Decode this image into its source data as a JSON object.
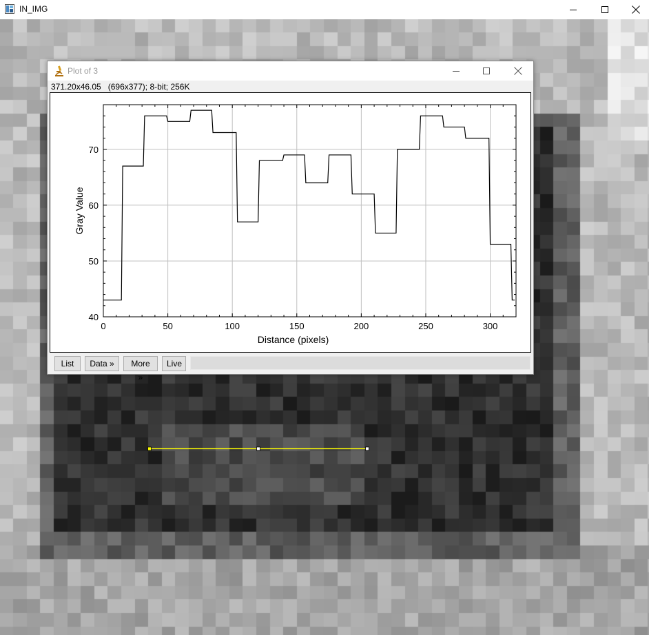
{
  "main_window": {
    "title": "IN_IMG",
    "icon": "imagej-image-icon",
    "controls": [
      "minimize-icon",
      "maximize-icon",
      "close-icon"
    ]
  },
  "plot_window": {
    "title": "Plot of 3",
    "icon": "microscope-icon",
    "info": "371.20x46.05   (696x377); 8-bit; 256K",
    "buttons": {
      "list": "List",
      "data": "Data »",
      "more": "More »",
      "live": "Live"
    },
    "status": ""
  },
  "colors": {
    "selection_line": "#ffff00",
    "plot_line": "#000000",
    "grid": "#c0c0c0"
  },
  "chart_data": {
    "type": "line",
    "step": true,
    "xlabel": "Distance (pixels)",
    "ylabel": "Gray Value",
    "xlim": [
      0,
      320
    ],
    "ylim": [
      40,
      78
    ],
    "xticks": [
      0,
      50,
      100,
      150,
      200,
      250,
      300
    ],
    "yticks": [
      40,
      50,
      60,
      70
    ],
    "grid": true,
    "series": [
      {
        "values": [
          [
            0,
            43
          ],
          [
            15,
            67
          ],
          [
            32,
            76
          ],
          [
            50,
            75
          ],
          [
            68,
            77
          ],
          [
            85,
            73
          ],
          [
            104,
            57
          ],
          [
            121,
            68
          ],
          [
            140,
            69
          ],
          [
            157,
            64
          ],
          [
            175,
            69
          ],
          [
            193,
            62
          ],
          [
            211,
            55
          ],
          [
            228,
            70
          ],
          [
            246,
            76
          ],
          [
            264,
            74
          ],
          [
            281,
            72
          ],
          [
            300,
            53
          ],
          [
            317,
            43
          ],
          [
            319,
            43
          ]
        ]
      }
    ]
  }
}
